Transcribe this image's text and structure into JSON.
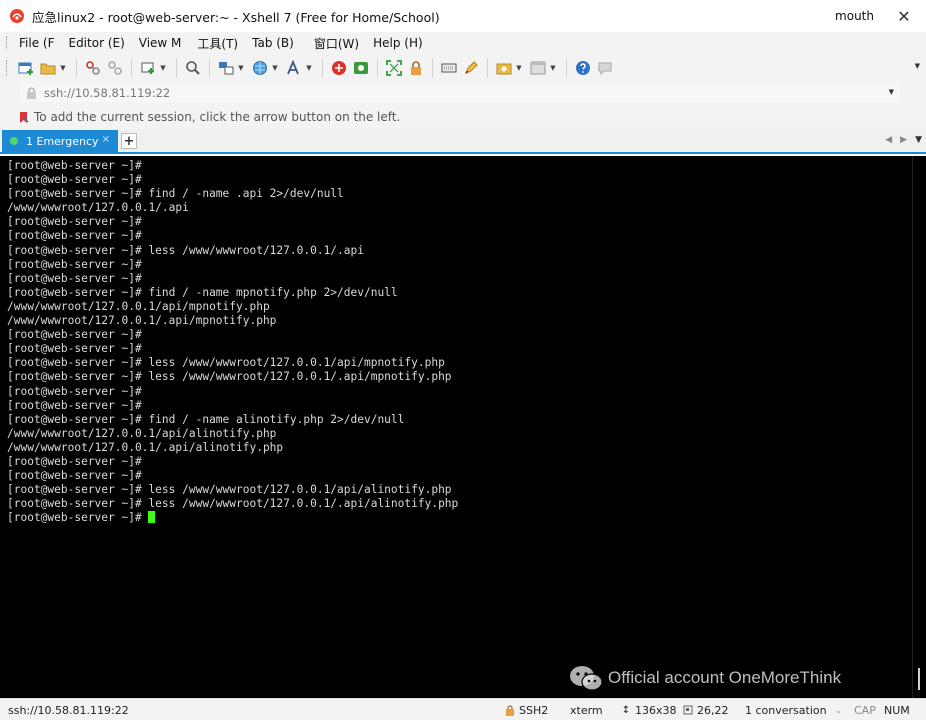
{
  "window": {
    "title": "应急linux2 - root@web-server:~ - Xshell 7 (Free for Home/School)",
    "user": "mouth",
    "close_glyph": "✕"
  },
  "menu": {
    "items": [
      "File (F",
      "Editor (E)",
      "View M",
      "工具(T)",
      "Tab (B)",
      "窗口(W)",
      "Help (H)"
    ]
  },
  "address": {
    "value": "ssh://10.58.81.119:22"
  },
  "hint": {
    "text": "To add the current session, click the arrow button on the left."
  },
  "tabs": [
    {
      "label": "1 Emergency",
      "close": "×"
    }
  ],
  "terminal": {
    "lines": [
      "[root@web-server ~]#",
      "[root@web-server ~]#",
      "[root@web-server ~]# find / -name .api 2>/dev/null",
      "/www/wwwroot/127.0.0.1/.api",
      "[root@web-server ~]#",
      "[root@web-server ~]#",
      "[root@web-server ~]# less /www/wwwroot/127.0.0.1/.api",
      "[root@web-server ~]#",
      "[root@web-server ~]#",
      "[root@web-server ~]# find / -name mpnotify.php 2>/dev/null",
      "/www/wwwroot/127.0.0.1/api/mpnotify.php",
      "/www/wwwroot/127.0.0.1/.api/mpnotify.php",
      "[root@web-server ~]#",
      "[root@web-server ~]#",
      "[root@web-server ~]# less /www/wwwroot/127.0.0.1/api/mpnotify.php",
      "[root@web-server ~]# less /www/wwwroot/127.0.0.1/.api/mpnotify.php",
      "[root@web-server ~]#",
      "[root@web-server ~]#",
      "[root@web-server ~]# find / -name alinotify.php 2>/dev/null",
      "/www/wwwroot/127.0.0.1/api/alinotify.php",
      "/www/wwwroot/127.0.0.1/.api/alinotify.php",
      "[root@web-server ~]#",
      "[root@web-server ~]#",
      "[root@web-server ~]# less /www/wwwroot/127.0.0.1/api/alinotify.php",
      "[root@web-server ~]# less /www/wwwroot/127.0.0.1/.api/alinotify.php"
    ],
    "prompt": "[root@web-server ~]# ",
    "cursor_color": "#39ff14"
  },
  "watermark": {
    "text": "Official account OneMoreThink"
  },
  "status": {
    "connection": "ssh://10.58.81.119:22",
    "protocol": "SSH2",
    "terminal_type": "xterm",
    "size": "136x38",
    "position": "26,22",
    "sessions": "1 conversation",
    "caps": "CAP",
    "num": "NUM"
  },
  "colors": {
    "tab_active": "#1e8ad6",
    "terminal_bg": "#000000",
    "terminal_fg": "#d9d9d9"
  }
}
